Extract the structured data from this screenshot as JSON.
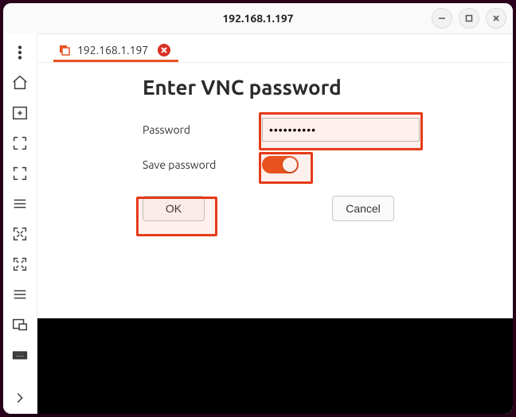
{
  "window": {
    "title": "192.168.1.197"
  },
  "tab": {
    "label": "192.168.1.197"
  },
  "dialog": {
    "heading": "Enter VNC password",
    "password_label": "Password",
    "password_value": "••••••••••",
    "save_label": "Save password",
    "save_on": true,
    "ok_label": "OK",
    "cancel_label": "Cancel"
  }
}
